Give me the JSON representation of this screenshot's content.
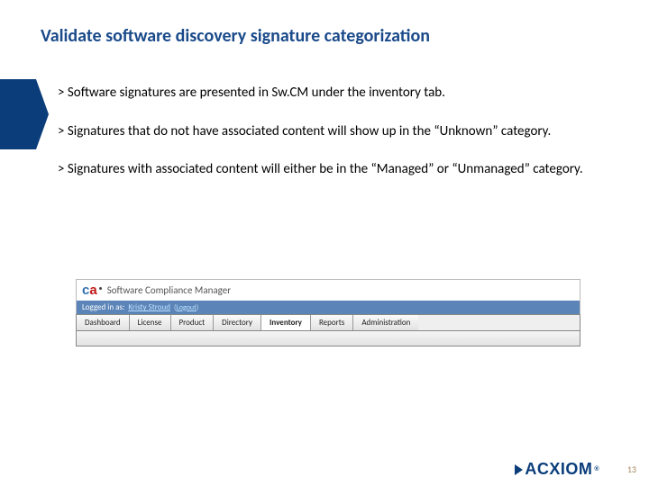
{
  "title": "Validate software discovery signature categorization",
  "bullets": {
    "chevron": ">",
    "items": [
      "Software signatures are presented in Sw.CM under the inventory tab.",
      "Signatures that do not have associated content will show up in the “Unknown” category.",
      "Signatures with associated content will either be in the “Managed” or “Unmanaged” category."
    ]
  },
  "screenshot": {
    "logo": {
      "c": "c",
      "a": "a"
    },
    "product": "Software Compliance Manager",
    "login": {
      "label": "Logged in as:",
      "user": "Kristy Stroud",
      "lp": "(",
      "logout": "Logout",
      "rp": ")"
    },
    "tabs": [
      {
        "label": "Dashboard",
        "active": false
      },
      {
        "label": "License",
        "active": false
      },
      {
        "label": "Product",
        "active": false
      },
      {
        "label": "Directory",
        "active": false
      },
      {
        "label": "Inventory",
        "active": true
      },
      {
        "label": "Reports",
        "active": false
      },
      {
        "label": "Administration",
        "active": false
      }
    ]
  },
  "brand": {
    "name": "ACXIOM",
    "reg": "®"
  },
  "page_number": "13"
}
